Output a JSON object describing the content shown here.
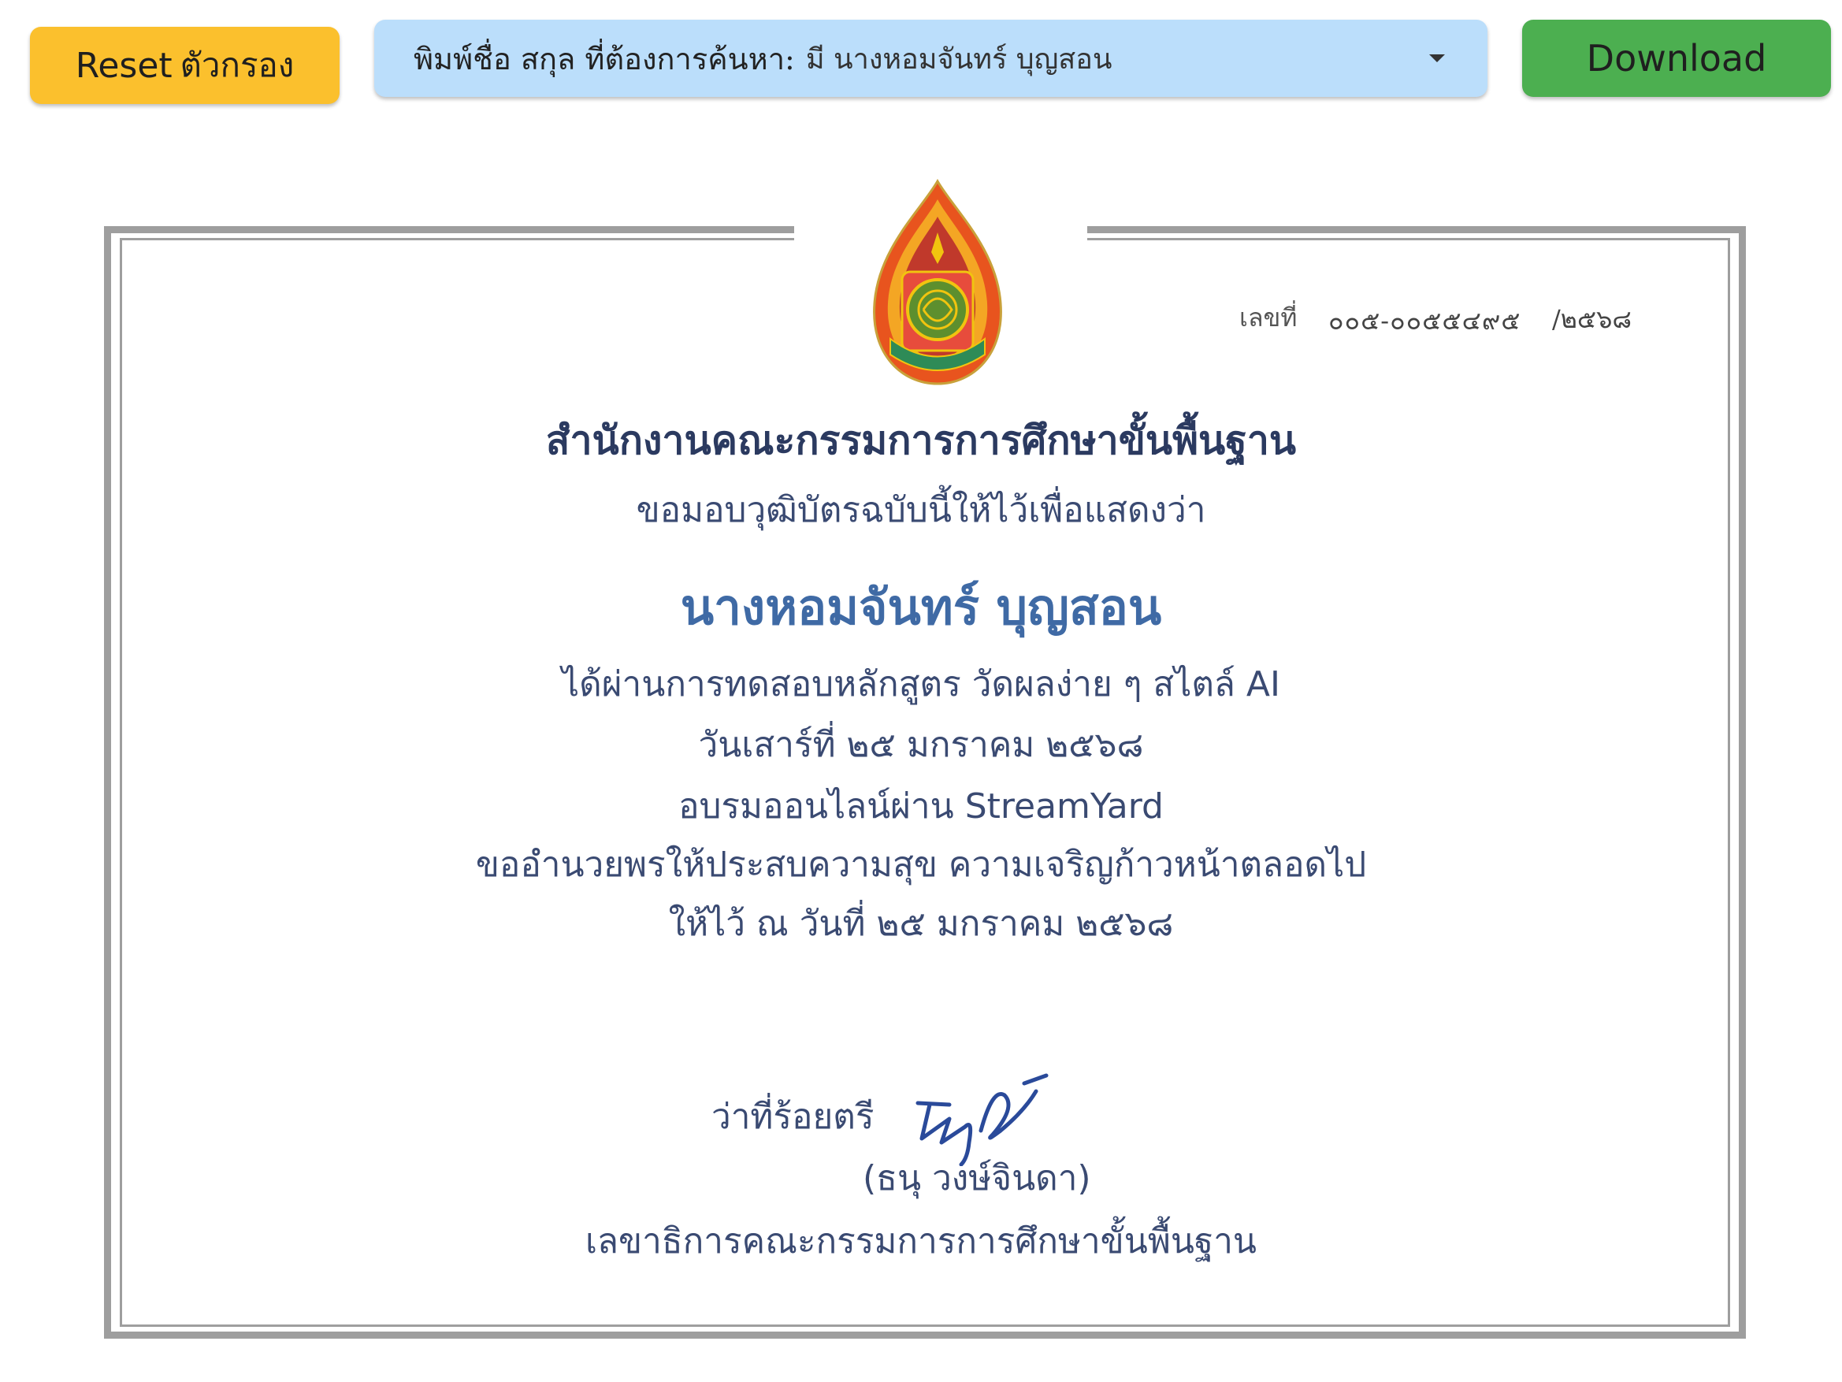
{
  "toolbar": {
    "reset_label": "Reset",
    "reset_label_thai": "ตัวกรอง",
    "download_label": "Download",
    "search": {
      "label": "พิมพ์ชื่อ สกุล ที่ต้องการค้นหา:",
      "value": "มี นางหอมจันทร์ บุญสอน"
    }
  },
  "certificate": {
    "number_label": "เลขที่",
    "number_value": "๐๐๕-๐๐๕๕๔๙๕",
    "number_year": "/๒๕๖๘",
    "organization": "สำนักงานคณะกรรมการการศึกษาขั้นพื้นฐาน",
    "intro": "ขอมอบวุฒิบัตรฉบับนี้ให้ไว้เพื่อแสดงว่า",
    "recipient": "นางหอมจันทร์ บุญสอน",
    "course": "ได้ผ่านการทดสอบหลักสูตร วัดผลง่าย ๆ สไตล์ AI",
    "date": "วันเสาร์ที่ ๒๕ มกราคม ๒๕๖๘",
    "venue": "อบรมออนไลน์ผ่าน StreamYard",
    "blessing": "ขออำนวยพรให้ประสบความสุข ความเจริญก้าวหน้าตลอดไป",
    "given": "ให้ไว้ ณ วันที่ ๒๕ มกราคม ๒๕๖๘",
    "signer_rank": "ว่าที่ร้อยตรี",
    "signer_name": "(ธนุ วงษ์จินดา)",
    "signer_title": "เลขาธิการคณะกรรมการการศึกษาขั้นพื้นฐาน"
  },
  "colors": {
    "reset_button": "#fbc02d",
    "download_button": "#4caf50",
    "search_box": "#bbdefb",
    "frame": "#9e9e9e",
    "recipient_name": "#3f6aa5",
    "body_text": "#3a4a72"
  },
  "icons": {
    "dropdown": "caret-down-icon",
    "seal": "obec-emblem"
  }
}
